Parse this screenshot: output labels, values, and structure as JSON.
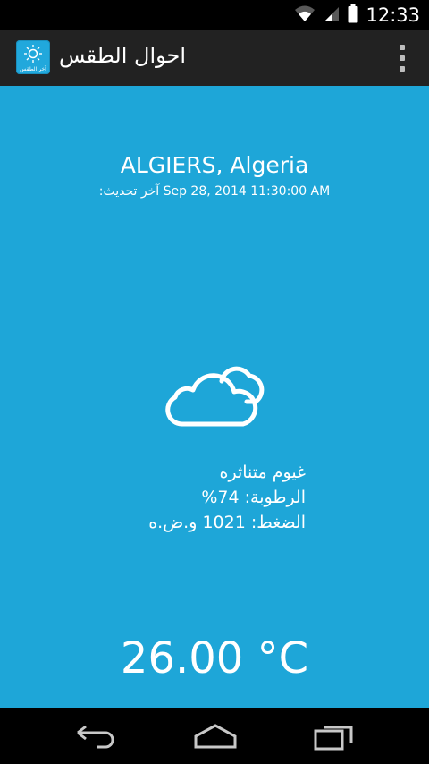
{
  "status_bar": {
    "time": "12:33"
  },
  "action_bar": {
    "title": "احوال الطقس",
    "app_icon_caption": "آخر الطقس"
  },
  "weather": {
    "location": "ALGIERS, Algeria",
    "last_update_label": "آخر تحديث:",
    "last_update_time": "Sep 28, 2014 11:30:00 AM",
    "condition": "غيوم متناثره",
    "humidity_label": "الرطوبة:",
    "humidity_value": "74%",
    "pressure_label": "الضغط:",
    "pressure_value": "1021 و.ض.ه",
    "temperature": "26.00 °C",
    "condition_icon": "cloud-icon"
  },
  "nav": {
    "icons": [
      "back-icon",
      "home-icon",
      "recent-apps-icon"
    ]
  },
  "colors": {
    "accent": "#1ea6d8",
    "action_bar": "#222222",
    "status_bar": "#000000"
  }
}
